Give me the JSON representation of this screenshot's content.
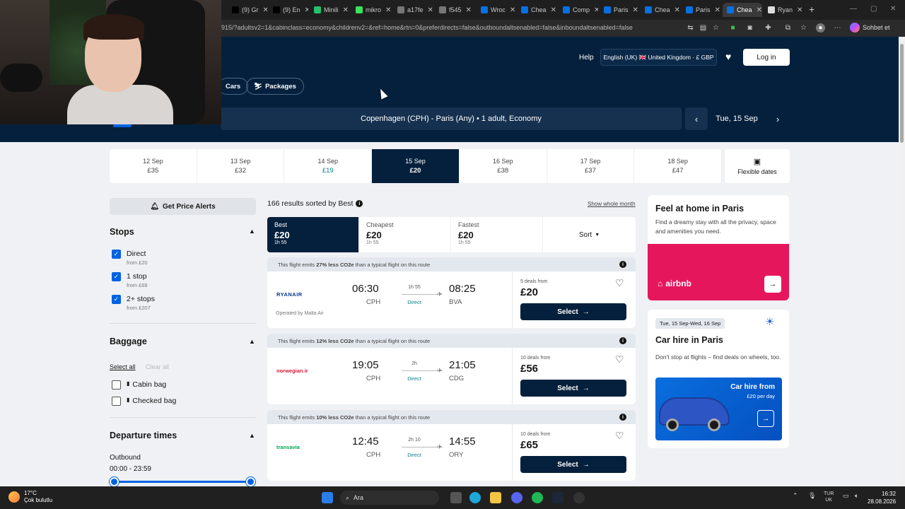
{
  "browser": {
    "tabs": [
      {
        "label": "(9) Gr",
        "color": "#000000"
      },
      {
        "label": "(9) En",
        "color": "#000000"
      },
      {
        "label": "Minili",
        "color": "#25c16f"
      },
      {
        "label": "mikro",
        "color": "#39e35a"
      },
      {
        "label": "a17fe",
        "color": "#777777"
      },
      {
        "label": "f545",
        "color": "#777777"
      },
      {
        "label": "Wroc",
        "color": "#0770e3"
      },
      {
        "label": "Chea",
        "color": "#0770e3"
      },
      {
        "label": "Comp",
        "color": "#0770e3"
      },
      {
        "label": "Paris",
        "color": "#0770e3"
      },
      {
        "label": "Chea",
        "color": "#0770e3"
      },
      {
        "label": "Paris",
        "color": "#0770e3"
      },
      {
        "label": "Chea",
        "color": "#0770e3"
      },
      {
        "label": "Ryan",
        "color": "#dddddd"
      }
    ],
    "active_tab_index": 12,
    "url": "915/?adultsv2=1&cabinclass=economy&childrenv2=&ref=home&rtn=0&preferdirects=false&outboundaltsenabled=false&inboundaltsenabled=false",
    "profile_label": "Sohbet et"
  },
  "header": {
    "help": "Help",
    "locale": "English (UK) 🇬🇧 United Kingdom · £ GBP",
    "login": "Log in",
    "categories": [
      {
        "label": "Cars",
        "icon": "car-icon"
      },
      {
        "label": "Packages",
        "icon": "packages-icon"
      }
    ],
    "search_summary": "Copenhagen (CPH) - Paris (Any)  •  1 adult, Economy",
    "current_date": "Tue, 15 Sep"
  },
  "date_strip": [
    {
      "date": "12 Sep",
      "price": "£35",
      "cheap": false
    },
    {
      "date": "13 Sep",
      "price": "£32",
      "cheap": false
    },
    {
      "date": "14 Sep",
      "price": "£19",
      "cheap": true
    },
    {
      "date": "15 Sep",
      "price": "£20",
      "cheap": false
    },
    {
      "date": "16 Sep",
      "price": "£38",
      "cheap": false
    },
    {
      "date": "17 Sep",
      "price": "£37",
      "cheap": false
    },
    {
      "date": "18 Sep",
      "price": "£47",
      "cheap": false
    }
  ],
  "active_date_index": 3,
  "flexible_dates": "Flexible dates",
  "filters": {
    "price_alerts": "Get Price Alerts",
    "stops_title": "Stops",
    "stops": [
      {
        "label": "Direct",
        "sub": "from £20",
        "checked": true
      },
      {
        "label": "1 stop",
        "sub": "from £69",
        "checked": true
      },
      {
        "label": "2+ stops",
        "sub": "from £207",
        "checked": true
      }
    ],
    "baggage_title": "Baggage",
    "select_all": "Select all",
    "clear_all": "Clear all",
    "baggage": [
      {
        "label": "Cabin bag",
        "checked": false
      },
      {
        "label": "Checked bag",
        "checked": false
      }
    ],
    "departure_title": "Departure times",
    "outbound_label": "Outbound",
    "outbound_range": "00:00 - 23:59"
  },
  "results": {
    "count_text": "166 results sorted by Best",
    "show_month": "Show whole month",
    "sort_tabs": [
      {
        "title": "Best",
        "price": "£20",
        "duration": "1h 55"
      },
      {
        "title": "Cheapest",
        "price": "£20",
        "duration": "1h 55"
      },
      {
        "title": "Fastest",
        "price": "£20",
        "duration": "1h 55"
      }
    ],
    "sort_label": "Sort",
    "flights": [
      {
        "co2_pre": "This flight emits ",
        "co2_pct": "27% less CO2e",
        "co2_post": " than a typical flight on this route",
        "airline": "RYANAIR",
        "airline_color": "#073590",
        "operated": "Operated by Malta Air",
        "dep": "06:30",
        "dep_code": "CPH",
        "arr": "08:25",
        "arr_code": "BVA",
        "duration": "1h 55",
        "stops": "Direct",
        "deals": "5 deals from",
        "price": "£20",
        "select": "Select"
      },
      {
        "co2_pre": "This flight emits ",
        "co2_pct": "12% less CO2e",
        "co2_post": " than a typical flight on this route",
        "airline": "norwegian.ir",
        "airline_color": "#d81939",
        "operated": "",
        "dep": "19:05",
        "dep_code": "CPH",
        "arr": "21:05",
        "arr_code": "CDG",
        "duration": "2h",
        "stops": "Direct",
        "deals": "10 deals from",
        "price": "£56",
        "select": "Select"
      },
      {
        "co2_pre": "This flight emits ",
        "co2_pct": "10% less CO2e",
        "co2_post": " than a typical flight on this route",
        "airline": "transavia",
        "airline_color": "#00a651",
        "operated": "",
        "dep": "12:45",
        "dep_code": "CPH",
        "arr": "14:55",
        "arr_code": "ORY",
        "duration": "2h 10",
        "stops": "Direct",
        "deals": "10 deals from",
        "price": "£65",
        "select": "Select"
      }
    ]
  },
  "ads": {
    "airbnb": {
      "title": "Feel at home in Paris",
      "text": "Find a dreamy stay with all the privacy, space and amenities you need.",
      "brand": "airbnb"
    },
    "car": {
      "badge": "Tue, 15 Sep-Wed, 16 Sep",
      "title": "Car hire in Paris",
      "text": "Don't stop at flights – find deals on wheels, too.",
      "img_title": "Car hire from",
      "img_sub": "£20 per day"
    }
  },
  "taskbar": {
    "temp": "17°C",
    "weather": "Çok bulutlu",
    "search": "Ara",
    "lang_top": "TUR",
    "lang_bottom": "UK",
    "time": "16:32",
    "date": "28.08.2026"
  }
}
